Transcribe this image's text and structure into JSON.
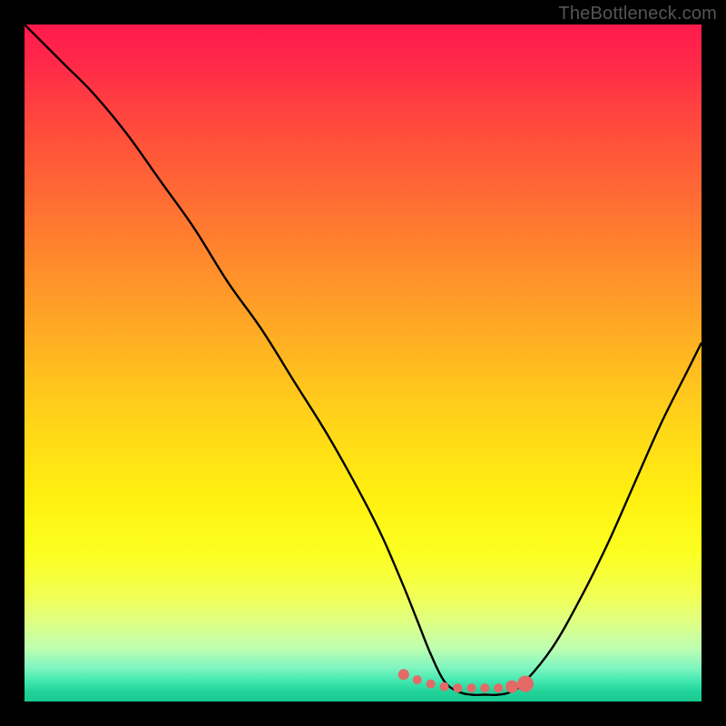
{
  "watermark": "TheBottleneck.com",
  "colors": {
    "frame": "#000000",
    "curve": "#000000",
    "marker_fill": "#e36a66",
    "marker_stroke": "#d85a56",
    "gradient_top": "#ff1a4d",
    "gradient_bottom": "#18c890"
  },
  "chart_data": {
    "type": "line",
    "title": "",
    "xlabel": "",
    "ylabel": "",
    "xlim": [
      0,
      100
    ],
    "ylim": [
      0,
      100
    ],
    "grid": false,
    "series": [
      {
        "name": "bottleneck-curve",
        "x": [
          0,
          3,
          6,
          10,
          15,
          20,
          25,
          30,
          35,
          40,
          45,
          50,
          53,
          56,
          58,
          60,
          62,
          64,
          66,
          68,
          70,
          72,
          74,
          78,
          82,
          86,
          90,
          94,
          98,
          100
        ],
        "y": [
          100,
          97,
          94,
          90,
          84,
          77,
          70,
          62,
          55,
          47,
          39,
          30,
          24,
          17,
          12,
          7,
          3,
          1.5,
          1,
          1,
          1,
          1.5,
          3,
          8,
          15,
          23,
          32,
          41,
          49,
          53
        ]
      }
    ],
    "markers": {
      "name": "optimal-range",
      "x": [
        56,
        58,
        60,
        62,
        64,
        66,
        68,
        70,
        72,
        74
      ],
      "y": [
        4,
        3.2,
        2.6,
        2.2,
        2,
        2,
        2,
        2,
        2.2,
        2.6
      ],
      "size": [
        6,
        5,
        5,
        5,
        5,
        5,
        5,
        5,
        7,
        9
      ]
    }
  }
}
